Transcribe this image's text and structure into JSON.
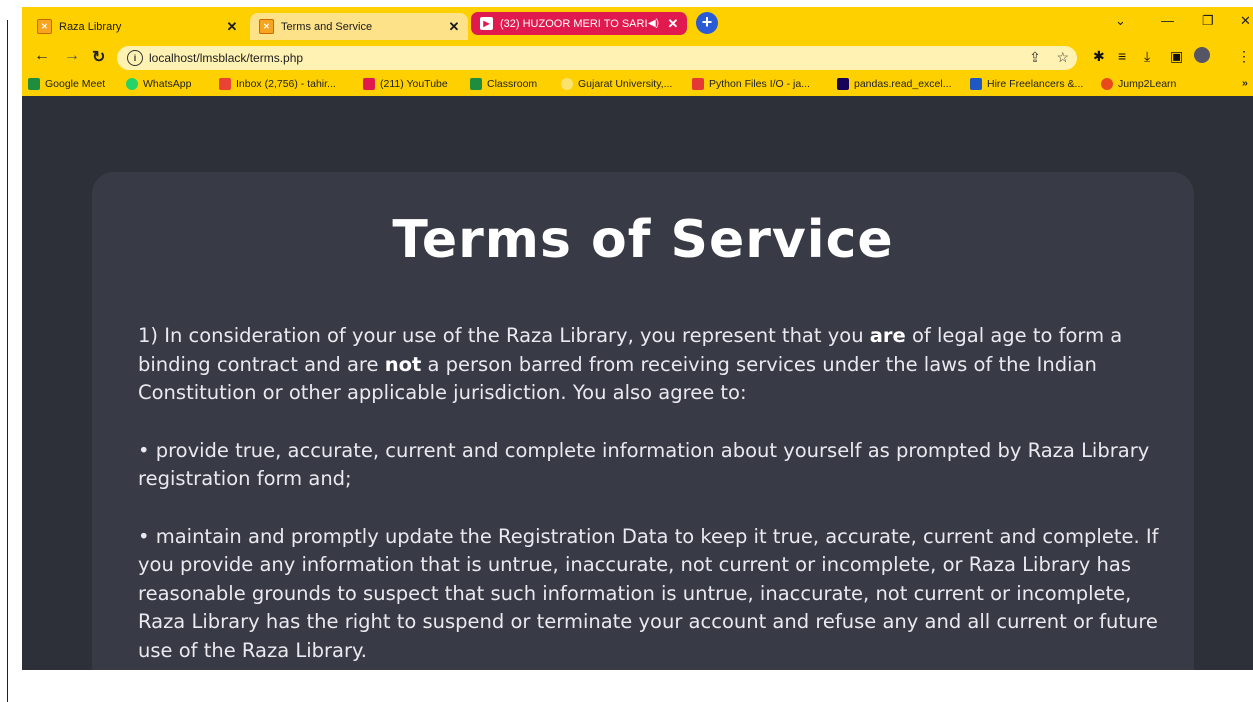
{
  "browser": {
    "tabs": [
      {
        "title": "Raza Library"
      },
      {
        "title": "Terms and Service"
      },
      {
        "title": "(32) HUZOOR MERI TO SARI"
      }
    ],
    "new_tab": "+",
    "address": "localhost/lmsblack/terms.php",
    "bookmarks": [
      {
        "label": "Google Meet",
        "color": "#1e8e3e"
      },
      {
        "label": "WhatsApp",
        "color": "#25d366"
      },
      {
        "label": "Inbox (2,756) - tahir...",
        "color": "#ea4335"
      },
      {
        "label": "(211) YouTube",
        "color": "#e01a4f"
      },
      {
        "label": "Classroom",
        "color": "#1e8e3e"
      },
      {
        "label": "Gujarat University,...",
        "color": "#f9d648"
      },
      {
        "label": "Python Files I/O - ja...",
        "color": "#e53935"
      },
      {
        "label": "pandas.read_excel...",
        "color": "#150458"
      },
      {
        "label": "Hire Freelancers &...",
        "color": "#1f57c3"
      },
      {
        "label": "Jump2Learn",
        "color": "#e8491d"
      }
    ]
  },
  "page": {
    "heading": "Terms of Service",
    "p1": {
      "a": "1) In consideration of your use of the Raza Library, you represent that you ",
      "b1": "are",
      "c": " of legal age to form a binding contract and are ",
      "b2": "not",
      "d": " a person barred from receiving services under the laws of the Indian Constitution or other applicable jurisdiction. You also agree to:"
    },
    "p2": "• provide true, accurate, current and complete information about yourself as prompted by Raza Library registration form and;",
    "p3": "• maintain and promptly update the Registration Data to keep it true, accurate, current and complete. If you provide any information that is untrue, inaccurate, not current or incomplete, or Raza Library has reasonable grounds to suspect that such information is untrue, inaccurate, not current or incomplete, Raza Library has the right to suspend or terminate your account and refuse any and all current or future use of the Raza Library."
  }
}
